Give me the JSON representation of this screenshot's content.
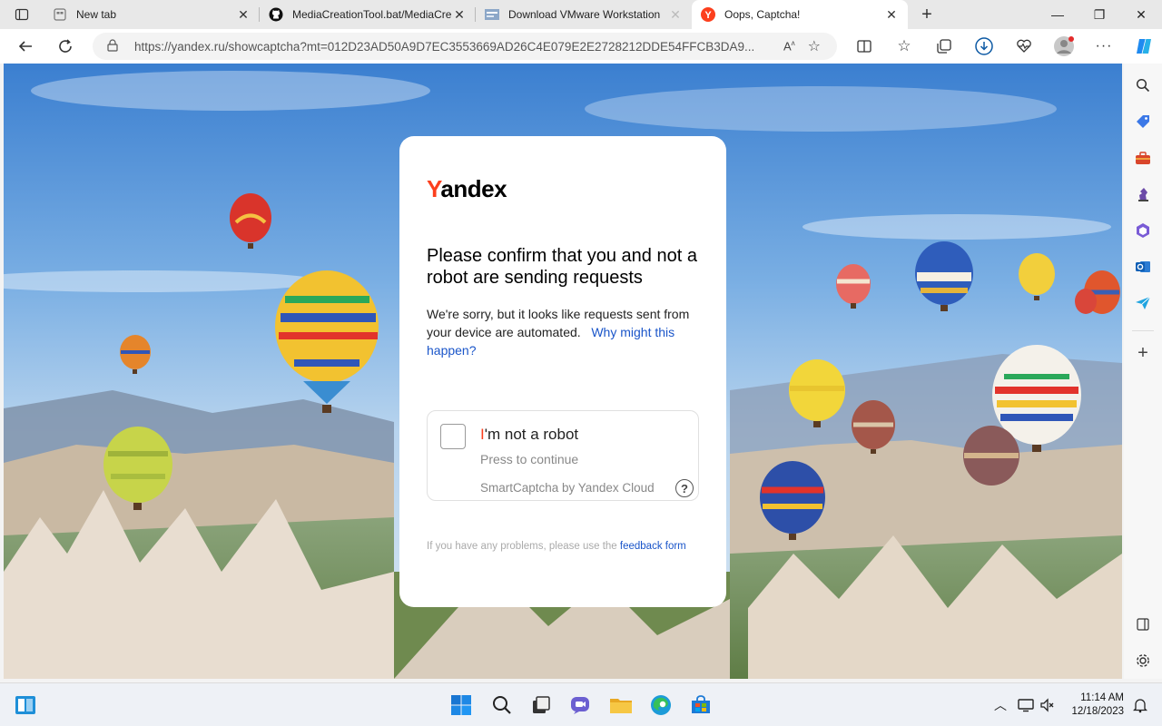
{
  "tabs": [
    {
      "title": "New tab",
      "icon": "newtab-icon"
    },
    {
      "title": "MediaCreationTool.bat/MediaCre",
      "icon": "github-icon"
    },
    {
      "title": "Download VMware Workstation",
      "icon": "vmware-icon"
    },
    {
      "title": "Oops, Captcha!",
      "icon": "yandex-icon",
      "active": true
    }
  ],
  "address_bar": {
    "url": "https://yandex.ru/showcaptcha?mt=012D23AD50A9D7EC3553669AD26C4E079E2E2728212DDE54FFCB3DA9..."
  },
  "page": {
    "logo_first": "Y",
    "logo_rest": "andex",
    "heading": "Please confirm that you and not a robot are sending requests",
    "body": "We're sorry, but it looks like requests sent from your device are automated.",
    "why_link": "Why might this happen?",
    "captcha": {
      "title_first": "I",
      "title_rest": "'m not a robot",
      "subtitle": "Press to continue",
      "brand": "SmartCaptcha by Yandex Cloud",
      "help": "?"
    },
    "footer_text": "If you have any problems, please use the",
    "footer_link": "feedback form"
  },
  "taskbar": {
    "time": "11:14 AM",
    "date": "12/18/2023"
  },
  "colors": {
    "yandex_red": "#fc3f1d",
    "link_blue": "#1a55c9",
    "edge_blue": "#0c59a4"
  }
}
